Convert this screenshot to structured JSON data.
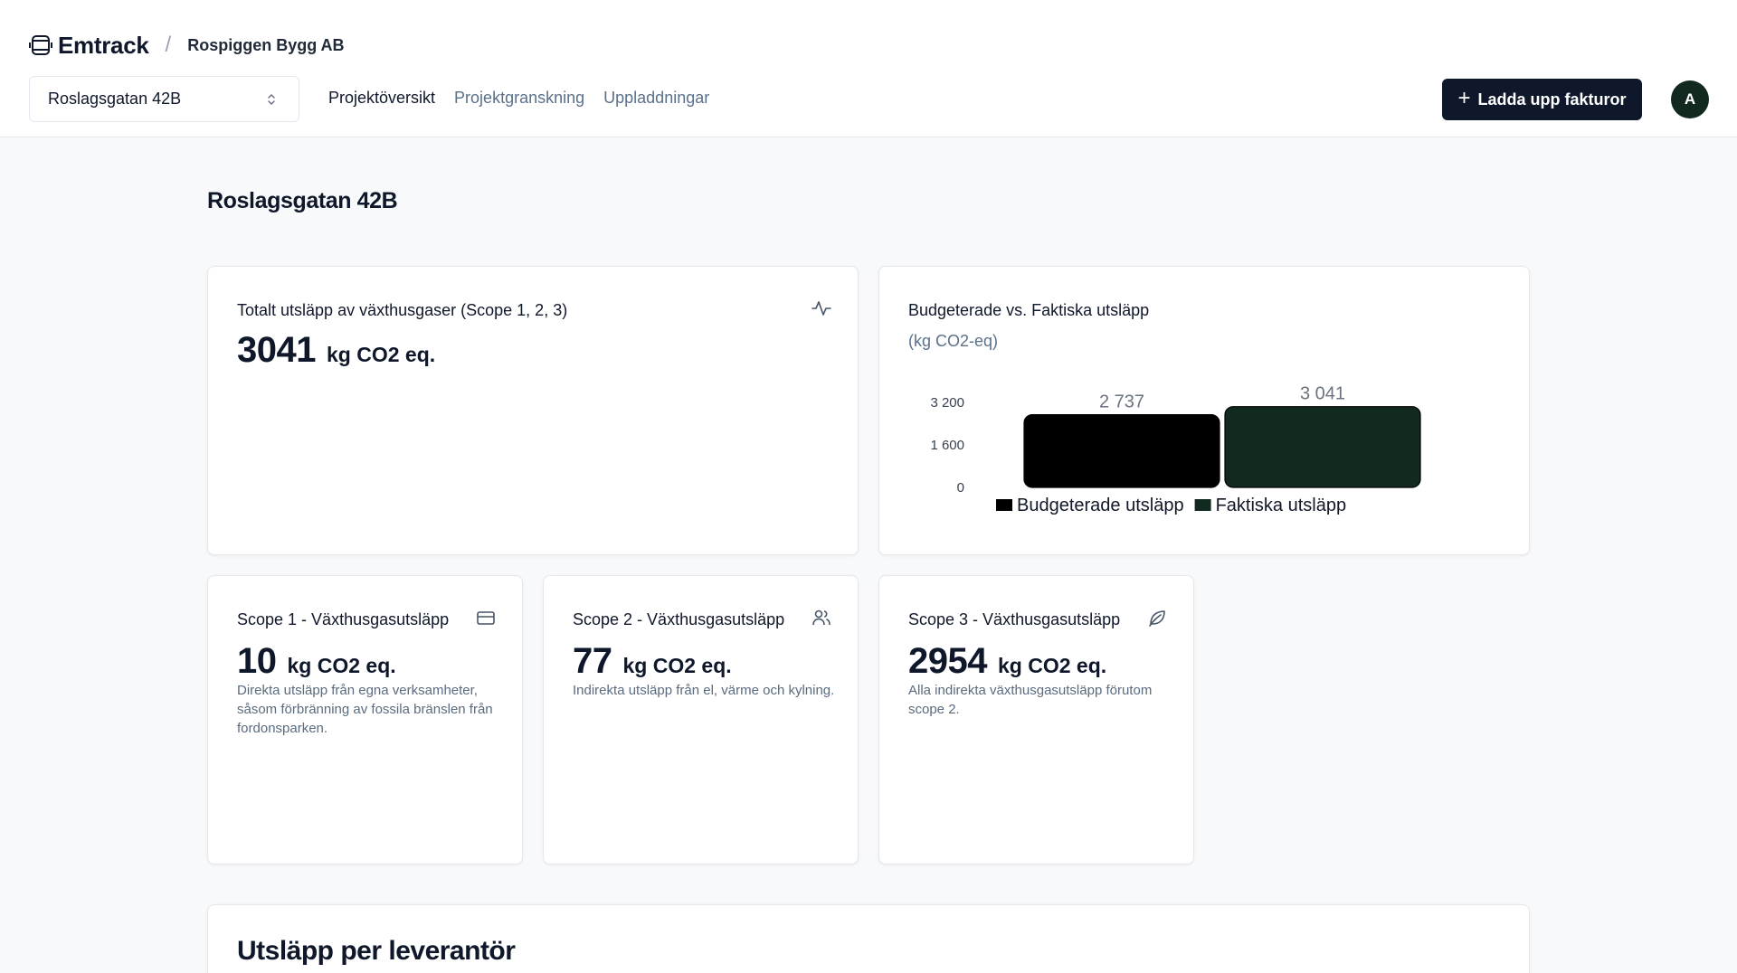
{
  "header": {
    "brand": "Emtrack",
    "separator": "/",
    "company": "Rospiggen Bygg AB",
    "project_select": {
      "value": "Roslagsgatan 42B"
    },
    "nav": [
      {
        "label": "Projektöversikt",
        "active": true
      },
      {
        "label": "Projektgranskning",
        "active": false
      },
      {
        "label": "Uppladdningar",
        "active": false
      }
    ],
    "upload_button": "Ladda upp fakturor",
    "avatar_initial": "A"
  },
  "page": {
    "title": "Roslagsgatan 42B"
  },
  "total_card": {
    "title": "Totalt utsläpp av växthusgaser (Scope 1, 2, 3)",
    "value": "3041",
    "unit": "kg CO2 eq.",
    "icon": "activity-icon"
  },
  "chart_card": {
    "title": "Budgeterade vs. Faktiska utsläpp",
    "subtitle": "(kg CO2-eq)"
  },
  "chart_data": {
    "type": "bar",
    "title": "Budgeterade vs. Faktiska utsläpp",
    "subtitle": "(kg CO2-eq)",
    "categories": [
      "Budgeterade utsläpp",
      "Faktiska utsläpp"
    ],
    "values": [
      2737,
      3041
    ],
    "value_labels": [
      "2 737",
      "3 041"
    ],
    "yticks": [
      0,
      1600,
      3200
    ],
    "ytick_labels": [
      "0",
      "1 600",
      "3 200"
    ],
    "ylim": [
      0,
      3200
    ],
    "colors": [
      "#000000",
      "#12291f"
    ],
    "legend": [
      "Budgeterade utsläpp",
      "Faktiska utsläpp"
    ],
    "legend_position": "bottom",
    "grid": false
  },
  "scope_cards": [
    {
      "title": "Scope 1 - Växthusgasutsläpp",
      "value": "10",
      "unit": "kg CO2 eq.",
      "description": "Direkta utsläpp från egna verksamheter, såsom förbränning av fossila bränslen från fordonsparken.",
      "icon": "credit-card-icon"
    },
    {
      "title": "Scope 2 - Växthusgasutsläpp",
      "value": "77",
      "unit": "kg CO2 eq.",
      "description": "Indirekta utsläpp från el, värme och kylning.",
      "icon": "users-icon"
    },
    {
      "title": "Scope 3 - Växthusgasutsläpp",
      "value": "2954",
      "unit": "kg CO2 eq.",
      "description": "Alla indirekta växthusgasutsläpp förutom scope 2.",
      "icon": "leaf-icon"
    }
  ],
  "supplier_section": {
    "title": "Utsläpp per leverantör"
  },
  "colors": {
    "primary": "#0f172a",
    "accent_green": "#12291f",
    "muted_text": "#5b7089"
  }
}
